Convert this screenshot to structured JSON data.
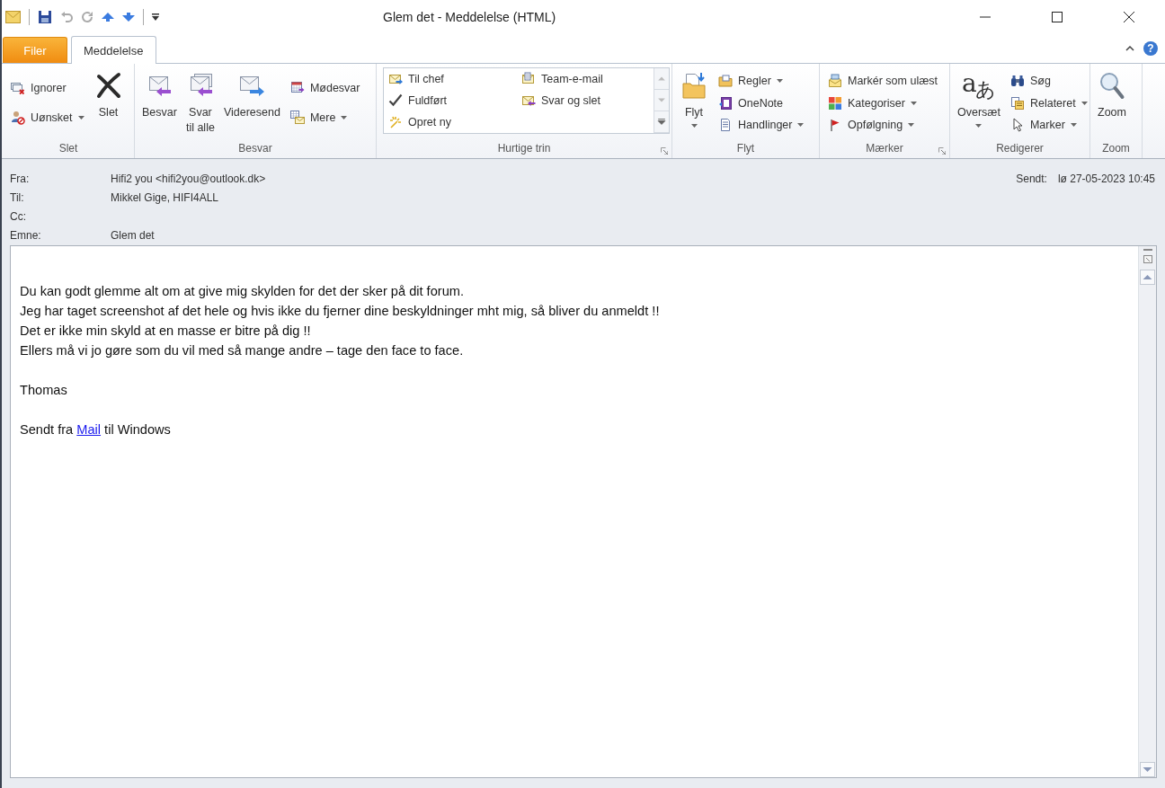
{
  "window": {
    "title": "Glem det - Meddelelse (HTML)"
  },
  "tabs": [
    {
      "label": "Filer",
      "kind": "file",
      "selected": false
    },
    {
      "label": "Meddelelse",
      "kind": "tab",
      "selected": true
    }
  ],
  "help": "?",
  "ribbon": {
    "groups": [
      {
        "label": "Slet",
        "launcher": false,
        "items": [
          {
            "kind": "stack",
            "items": [
              {
                "label": "Ignorer",
                "menu": false
              },
              {
                "label": "Uønsket",
                "menu": true
              }
            ]
          },
          {
            "kind": "large",
            "label": "Slet",
            "menu": false
          }
        ]
      },
      {
        "label": "Besvar",
        "launcher": false,
        "items": [
          {
            "kind": "large",
            "label": "Besvar",
            "menu": false
          },
          {
            "kind": "large",
            "label": "Svar\ntil alle",
            "menu": false
          },
          {
            "kind": "large",
            "label": "Videresend",
            "menu": false
          },
          {
            "kind": "stack",
            "items": [
              {
                "label": "Mødesvar",
                "menu": false
              },
              {
                "label": "Mere",
                "menu": true
              }
            ]
          }
        ]
      },
      {
        "label": "Hurtige trin",
        "launcher": true,
        "items": [
          {
            "kind": "gallery",
            "items": [
              {
                "label": "Til chef"
              },
              {
                "label": "Team-e-mail"
              },
              {
                "label": "Fuldført"
              },
              {
                "label": "Svar og slet"
              },
              {
                "label": "Opret ny"
              }
            ]
          }
        ]
      },
      {
        "label": "Flyt",
        "launcher": false,
        "items": [
          {
            "kind": "large",
            "label": "Flyt",
            "menu": true
          },
          {
            "kind": "stack",
            "items": [
              {
                "label": "Regler",
                "menu": true
              },
              {
                "label": "OneNote",
                "menu": false
              },
              {
                "label": "Handlinger",
                "menu": true
              }
            ]
          }
        ]
      },
      {
        "label": "Mærker",
        "launcher": true,
        "items": [
          {
            "kind": "stack",
            "items": [
              {
                "label": "Markér som ulæst",
                "menu": false
              },
              {
                "label": "Kategoriser",
                "menu": true
              },
              {
                "label": "Opfølgning",
                "menu": true
              }
            ]
          }
        ]
      },
      {
        "label": "Redigerer",
        "launcher": false,
        "items": [
          {
            "kind": "large",
            "label": "Oversæt",
            "menu": true,
            "icon_glyphs": [
              "a",
              "あ"
            ]
          },
          {
            "kind": "stack",
            "items": [
              {
                "label": "Søg",
                "menu": false
              },
              {
                "label": "Relateret",
                "menu": true
              },
              {
                "label": "Marker",
                "menu": true
              }
            ]
          }
        ]
      },
      {
        "label": "Zoom",
        "launcher": false,
        "items": [
          {
            "kind": "large",
            "label": "Zoom",
            "menu": false
          }
        ]
      }
    ]
  },
  "header": {
    "fields": [
      {
        "label": "Fra:",
        "value": "Hifi2 you <hifi2you@outlook.dk>"
      },
      {
        "label": "Til:",
        "value": "Mikkel Gige, HIFI4ALL"
      },
      {
        "label": "Cc:"
      },
      {
        "label": "Emne:",
        "value": "Glem det"
      }
    ],
    "sent": {
      "label": "Sendt:",
      "value": "lø 27-05-2023 10:45"
    }
  },
  "body": {
    "paragraphs": [
      {
        "kind": "text",
        "lines": [
          "Du kan godt glemme alt om at give mig skylden for det der sker på dit forum.",
          "Jeg har taget screenshot af det hele og hvis ikke du fjerner dine beskyldninger mht mig, så bliver du anmeldt !!",
          "Det er ikke min skyld at en masse er bitre på dig !!",
          "Ellers må vi jo gøre som du vil med så mange andre – tage den face to face."
        ]
      },
      {
        "kind": "text",
        "lines": [
          "Thomas"
        ]
      },
      {
        "kind": "link",
        "before": "Sendt fra",
        "link": "Mail",
        "after": "til Windows"
      }
    ]
  }
}
